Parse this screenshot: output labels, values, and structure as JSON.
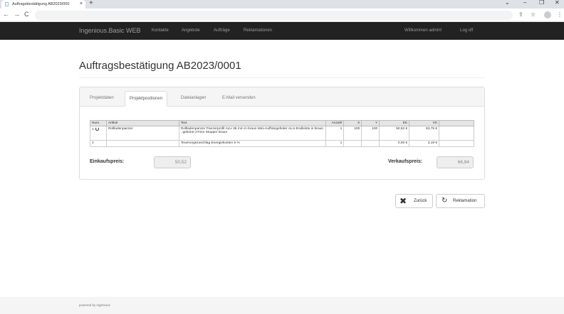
{
  "browser": {
    "tab_title": "Auftragsbestätigung AB2023/000",
    "tab_close": "×",
    "new_tab": "+",
    "back": "←",
    "forward": "→",
    "reload": "C",
    "share": "⇪",
    "bookmark": "☆",
    "sidepanel": "◧",
    "menu": "⋮",
    "chevron": "⌄",
    "minimize": "–",
    "maximize": "❐",
    "close": "✕"
  },
  "navbar": {
    "brand": "Ingenious.Basic WEB",
    "links": [
      "Kontakte",
      "Angebote",
      "Aufträge",
      "Reklamationen"
    ],
    "welcome": "Willkommen admin!",
    "logout": "Log off"
  },
  "page": {
    "title": "Auftragsbestätigung AB2023/0001"
  },
  "tabs": [
    "Projektdaten",
    "Projektpositionen",
    "Dateianlagen",
    "E-Mail versenden"
  ],
  "table": {
    "headers": [
      "Num.",
      "Artikel",
      "Text",
      "Anzahl",
      "X",
      "Y",
      "EK",
      "VK",
      ""
    ],
    "rows": [
      {
        "num": "1",
        "artikel": "Rollladenpanzer",
        "text": "Rollladenpanzer Panzerprofil ALU 36 mm in braun Mini-Aufhängefeder ALU-Endleiste in braun , gebohrt 27mm Stopper braun",
        "anzahl": "1",
        "x": "100",
        "y": "100",
        "ek": "50,52 €",
        "vk": "63,75 €",
        "extra": ""
      },
      {
        "num": "2",
        "artikel": "",
        "text": "Teuerungszuschlag Energiekosten 5 %",
        "anzahl": "1",
        "x": "",
        "y": "",
        "ek": "0,00 €",
        "vk": "3,19 €",
        "extra": ""
      }
    ]
  },
  "summary": {
    "einkauf_label": "Einkaufspreis:",
    "einkauf_value": "50,52",
    "verkauf_label": "Verkaufspreis:",
    "verkauf_value": "66,94"
  },
  "buttons": {
    "back_label": "Zurück",
    "reklamation_label": "Reklamation"
  },
  "footer": {
    "text": "powered by ingenious"
  }
}
